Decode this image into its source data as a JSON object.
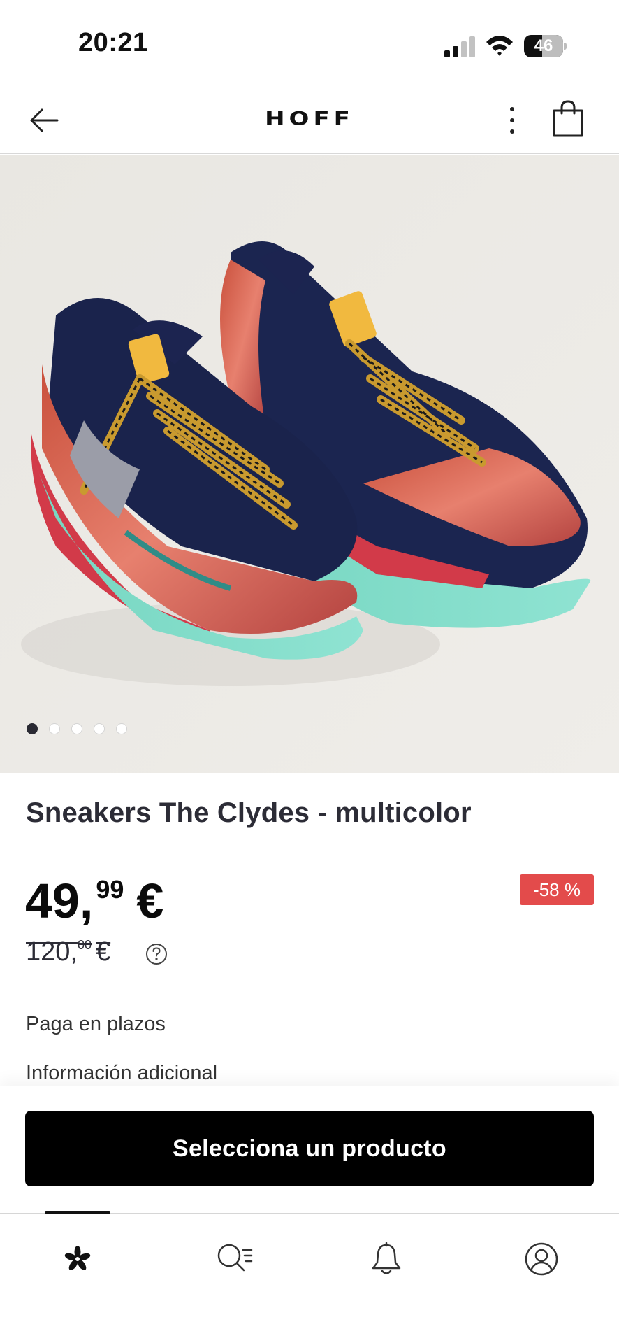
{
  "status_bar": {
    "time": "20:21",
    "battery_level": "46"
  },
  "header": {
    "brand": "HOFF",
    "back_icon": "arrow-left-icon",
    "more_icon": "more-vertical-icon",
    "cart_icon": "shopping-bag-icon"
  },
  "gallery": {
    "image_description_icon": "sneakers-photo",
    "slide_count": 5,
    "active_slide": 1
  },
  "product": {
    "title": "Sneakers The Clydes - multicolor",
    "price": {
      "integer": "49,",
      "cents": "99",
      "currency": "€"
    },
    "old_price": {
      "integer": "120,",
      "cents": "00",
      "currency": "€"
    },
    "discount": "-58 %",
    "discount_color": "#e34b4b"
  },
  "links": {
    "installments": "Paga en plazos",
    "additional_info": "Información adicional"
  },
  "cta": {
    "label": "Selecciona un producto"
  },
  "bottom_nav": {
    "items": [
      {
        "icon": "flower-home-icon",
        "active": true
      },
      {
        "icon": "search-list-icon",
        "active": false
      },
      {
        "icon": "bell-icon",
        "active": false
      },
      {
        "icon": "user-account-icon",
        "active": false
      }
    ]
  }
}
